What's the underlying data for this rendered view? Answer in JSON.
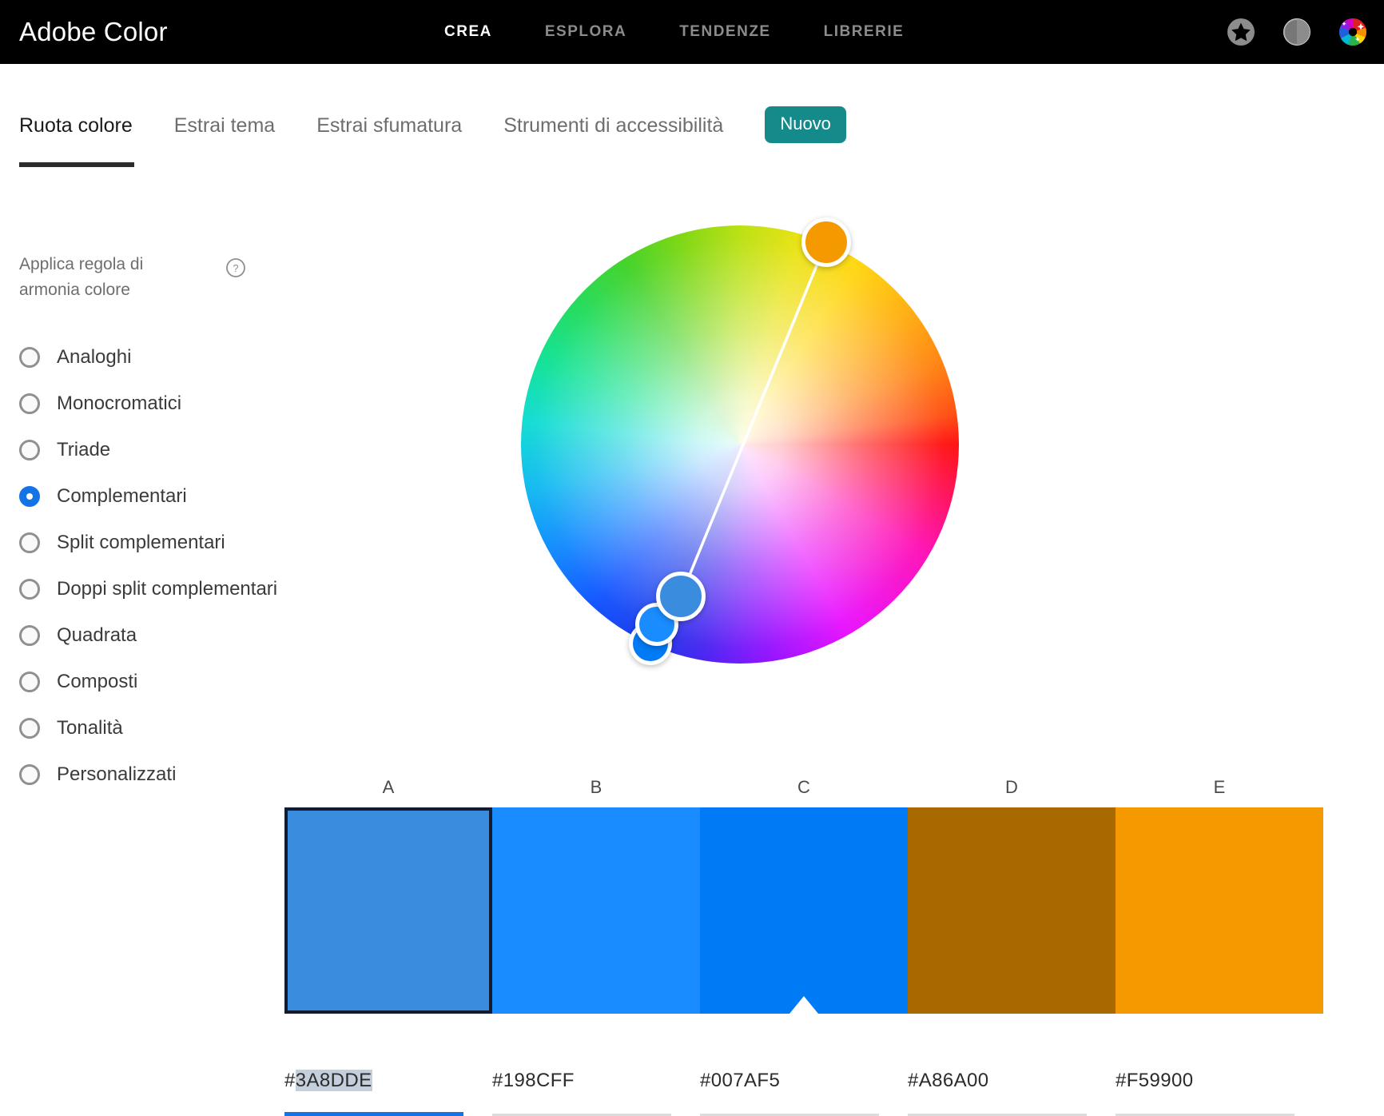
{
  "header": {
    "brand": "Adobe Color",
    "nav": [
      {
        "label": "CREA",
        "active": true
      },
      {
        "label": "ESPLORA",
        "active": false
      },
      {
        "label": "TENDENZE",
        "active": false
      },
      {
        "label": "LIBRERIE",
        "active": false
      }
    ],
    "icons": [
      "star-circle-icon",
      "contrast-circle-icon",
      "color-wheel-avatar-icon"
    ]
  },
  "tabs": {
    "items": [
      {
        "label": "Ruota colore",
        "active": true
      },
      {
        "label": "Estrai tema",
        "active": false
      },
      {
        "label": "Estrai sfumatura",
        "active": false
      },
      {
        "label": "Strumenti di accessibilità",
        "active": false
      }
    ],
    "badge": "Nuovo",
    "badge_color": "#148A8A"
  },
  "sidebar": {
    "title": "Applica regola di armonia colore",
    "help_icon": "question-circle-icon",
    "rules": [
      {
        "label": "Analoghi",
        "selected": false
      },
      {
        "label": "Monocromatici",
        "selected": false
      },
      {
        "label": "Triade",
        "selected": false
      },
      {
        "label": "Complementari",
        "selected": true
      },
      {
        "label": "Split complementari",
        "selected": false
      },
      {
        "label": "Doppi split complementari",
        "selected": false
      },
      {
        "label": "Quadrata",
        "selected": false
      },
      {
        "label": "Composti",
        "selected": false
      },
      {
        "label": "Tonalità",
        "selected": false
      },
      {
        "label": "Personalizzati",
        "selected": false
      }
    ],
    "selected_rule": "Complementari",
    "accent_color": "#1473E6"
  },
  "wheel": {
    "handles": [
      {
        "id": "A",
        "color": "#3A8DDE"
      },
      {
        "id": "B",
        "color": "#198CFF"
      },
      {
        "id": "C",
        "color": "#007AF5"
      },
      {
        "id": "E",
        "color": "#F59900"
      }
    ],
    "line_color": "#FFFFFF"
  },
  "palette": {
    "labels": [
      "A",
      "B",
      "C",
      "D",
      "E"
    ],
    "swatches": [
      {
        "label": "A",
        "hex": "#3A8DDE",
        "selected": true,
        "marker": false
      },
      {
        "label": "B",
        "hex": "#198CFF",
        "selected": false,
        "marker": false
      },
      {
        "label": "C",
        "hex": "#007AF5",
        "selected": false,
        "marker": true
      },
      {
        "label": "D",
        "hex": "#A86A00",
        "selected": false,
        "marker": false
      },
      {
        "label": "E",
        "hex": "#F59900",
        "selected": false,
        "marker": false
      }
    ],
    "hex_fields": [
      {
        "prefix": "#",
        "value": "3A8DDE",
        "active": true,
        "selected_text": true
      },
      {
        "prefix": "#",
        "value": "198CFF",
        "active": false,
        "selected_text": false
      },
      {
        "prefix": "#",
        "value": "007AF5",
        "active": false,
        "selected_text": false
      },
      {
        "prefix": "#",
        "value": "A86A00",
        "active": false,
        "selected_text": false
      },
      {
        "prefix": "#",
        "value": "F59900",
        "active": false,
        "selected_text": false
      }
    ]
  }
}
